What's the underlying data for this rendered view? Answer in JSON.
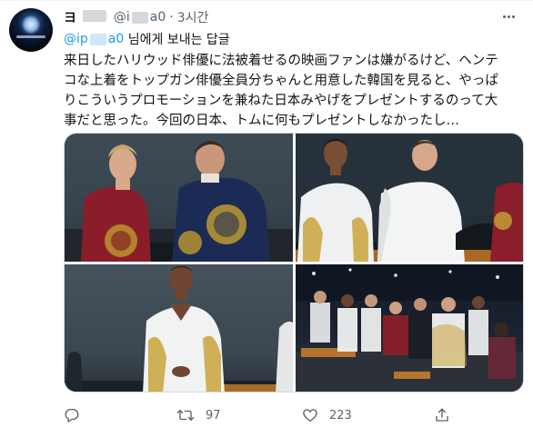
{
  "tweet": {
    "author_name_prefix": "ヨ",
    "handle_prefix": "@i",
    "handle_suffix": "a0",
    "separator": "·",
    "time": "3시간",
    "replying": {
      "mention_prefix": "@ip",
      "mention_suffix": "a0",
      "suffix": " 님에게 보내는 답글"
    },
    "text_lines": [
      "来日したハリウッド俳優に法被着せるの映画ファンは嫌がるけど、ヘンテ",
      "コな上着をトップガン俳優全員分ちゃんと用意した韓国を見ると、やっぱ",
      "りこういうプロモーションを兼ねた日本みやげをプレゼントするのって大",
      "事だと思った。今回の日本、トムに何もプレゼントしなかったし…"
    ],
    "media": [
      {
        "icon": "photo-1"
      },
      {
        "icon": "photo-2"
      },
      {
        "icon": "photo-3"
      },
      {
        "icon": "photo-4"
      }
    ],
    "actions": {
      "reply_count": "",
      "retweet_count": "97",
      "like_count": "223"
    }
  },
  "colors": {
    "accent": "#1d9bf0",
    "secondary_text": "#536471",
    "primary_text": "#0f1419",
    "border": "#cfd9de"
  }
}
